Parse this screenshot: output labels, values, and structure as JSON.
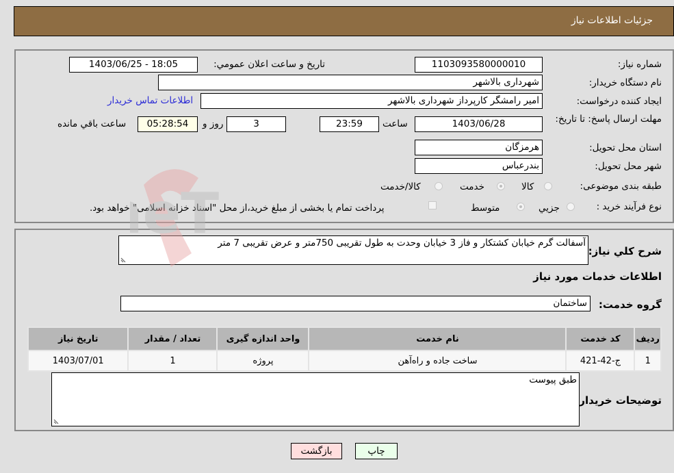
{
  "header": {
    "title": "جزئیات اطلاعات نیاز"
  },
  "form": {
    "need_number": {
      "label": "شماره نیاز:",
      "value": "1103093580000010"
    },
    "announce_datetime": {
      "label": "تاریخ و ساعت اعلان عمومي:",
      "value": "1403/06/25 - 18:05"
    },
    "buyer_org": {
      "label": "نام دستگاه خریدار:",
      "value": "شهرداری بالاشهر"
    },
    "requester": {
      "label": "ایجاد کننده درخواست:",
      "value": "امیر رامشگر کارپرداز شهرداری بالاشهر"
    },
    "buyer_contact_link": "اطلاعات تماس خریدار",
    "deadline": {
      "label": "مهلت ارسال پاسخ: تا تاریخ:",
      "date": "1403/06/28",
      "time_label": "ساعت",
      "time": "23:59",
      "days": "3",
      "days_label": "روز و",
      "remaining": "05:28:54",
      "remaining_label": "ساعت باقي مانده"
    },
    "province": {
      "label": "استان محل تحویل:",
      "value": "هرمزگان"
    },
    "city": {
      "label": "شهر محل تحویل:",
      "value": "بندرعباس"
    },
    "category": {
      "label": "طبقه بندی موضوعی:",
      "options": [
        "کالا",
        "خدمت",
        "کالا/خدمت"
      ],
      "selected": "خدمت"
    },
    "purchase_type": {
      "label": "نوع فرآیند خرید :",
      "options": [
        "جزيي",
        "متوسط"
      ],
      "selected": "متوسط",
      "treasury_note": "پرداخت تمام یا بخشی از مبلغ خرید،از محل \"اسناد خزانه اسلامی\" خواهد بود.",
      "treasury_checked": false
    }
  },
  "description": {
    "label": "شرح کلي نیاز:",
    "value": "آسفالت گرم خیابان کشتکار و فاز 3 خیابان وحدت به طول تقریبی 750متر و عرض تقریبی 7 متر"
  },
  "services": {
    "section_title": "اطلاعات خدمات مورد نیاز",
    "group_label": "گروه خدمت:",
    "group_value": "ساختمان",
    "columns": [
      "ردیف",
      "کد خدمت",
      "نام خدمت",
      "واحد اندازه گیری",
      "تعداد / مقدار",
      "تاریخ نیاز"
    ],
    "rows": [
      [
        "1",
        "ج-42-421",
        "ساخت جاده و راه‌آهن",
        "پروژه",
        "1",
        "1403/07/01"
      ]
    ]
  },
  "buyer_notes": {
    "label": "توضیحات خریدار:",
    "value": "طبق پیوست"
  },
  "buttons": {
    "print": "چاپ",
    "back": "بازگشت"
  },
  "colors": {
    "header_bg": "#8e6d43",
    "print_bg": "#eaffea",
    "back_bg": "#ffdede",
    "link": "#2b2bd6"
  }
}
